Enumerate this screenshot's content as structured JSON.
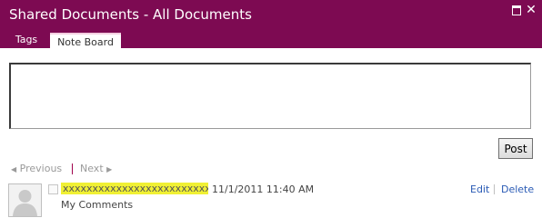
{
  "window": {
    "title": "Shared Documents - All Documents"
  },
  "tabs": [
    {
      "label": "Tags"
    },
    {
      "label": "Note Board"
    }
  ],
  "note_input": {
    "value": ""
  },
  "post_button": {
    "label": "Post"
  },
  "pager": {
    "previous": "Previous",
    "next": "Next"
  },
  "notes": [
    {
      "author": "xxxxxxxxxxxxxxxxxxxxxxxxxxx",
      "timestamp": "11/1/2011 11:40 AM",
      "comment": "My Comments",
      "edit_label": "Edit",
      "delete_label": "Delete"
    }
  ],
  "colors": {
    "titlebar": "#7d0a52",
    "author_highlight": "#f0f034",
    "link": "#2a5bb5",
    "pager_text": "#9a9a9a"
  },
  "icons": [
    "maximize-icon",
    "close-icon",
    "previous-arrow-icon",
    "next-arrow-icon",
    "avatar-placeholder-icon"
  ]
}
